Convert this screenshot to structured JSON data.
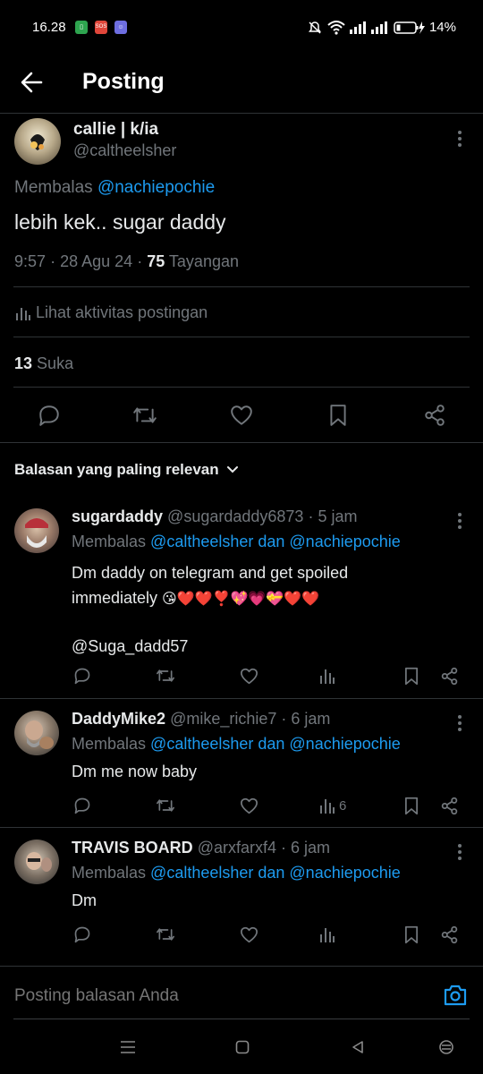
{
  "status_bar": {
    "time": "16.28",
    "battery": "14%",
    "notif_badges": [
      {
        "color": "#2ea44f",
        "text": "▯"
      },
      {
        "color": "#e0463a",
        "text": "SOS"
      },
      {
        "color": "#6e6ee0",
        "text": "☺"
      }
    ]
  },
  "header": {
    "title": "Posting"
  },
  "main_post": {
    "author_name": "callie | k/ia",
    "author_handle": "@caltheelsher",
    "reply_prefix": "Membalas",
    "reply_target": "@nachiepochie",
    "text": "lebih kek.. sugar daddy",
    "time": "9:57",
    "date": "28 Agu 24",
    "views_count": "75",
    "views_label": "Tayangan",
    "activity_label": "Lihat aktivitas postingan",
    "likes_count": "13",
    "likes_label": "Suka"
  },
  "replies_sort": {
    "label": "Balasan yang paling relevan"
  },
  "replies": [
    {
      "name": "sugardaddy",
      "handle": "@sugardaddy6873",
      "age": "5 jam",
      "reply_prefix": "Membalas",
      "reply_targets": "@caltheelsher dan @nachiepochie",
      "text_line1": "Dm daddy on telegram and get spoiled",
      "text_line2": "immediately",
      "emojis": "😘❤️❤️❣️💖💗💝❤️❤️",
      "text_line3": "@Suga_dadd57",
      "views": ""
    },
    {
      "name": "DaddyMike2",
      "handle": "@mike_richie7",
      "age": "6 jam",
      "reply_prefix": "Membalas",
      "reply_targets": "@caltheelsher dan @nachiepochie",
      "text_line1": "Dm me now baby",
      "views": "6"
    },
    {
      "name": "TRAVIS BOARD",
      "handle": "@arxfarxf4",
      "age": "6 jam",
      "reply_prefix": "Membalas",
      "reply_targets": "@caltheelsher dan @nachiepochie",
      "text_line1": "Dm",
      "views": ""
    }
  ],
  "compose": {
    "placeholder": "Posting balasan Anda"
  },
  "icons": {
    "back": "arrow-left-icon",
    "more": "kebab-icon",
    "reply": "comment-icon",
    "repost": "repost-icon",
    "like": "heart-icon",
    "views": "bar-chart-icon",
    "bookmark": "bookmark-icon",
    "share": "share-icon",
    "camera": "camera-icon"
  },
  "colors": {
    "accent": "#1d9bf0",
    "background": "#000000",
    "text": "#e7e9ea",
    "muted": "#71767b",
    "divider": "#2f3336"
  }
}
